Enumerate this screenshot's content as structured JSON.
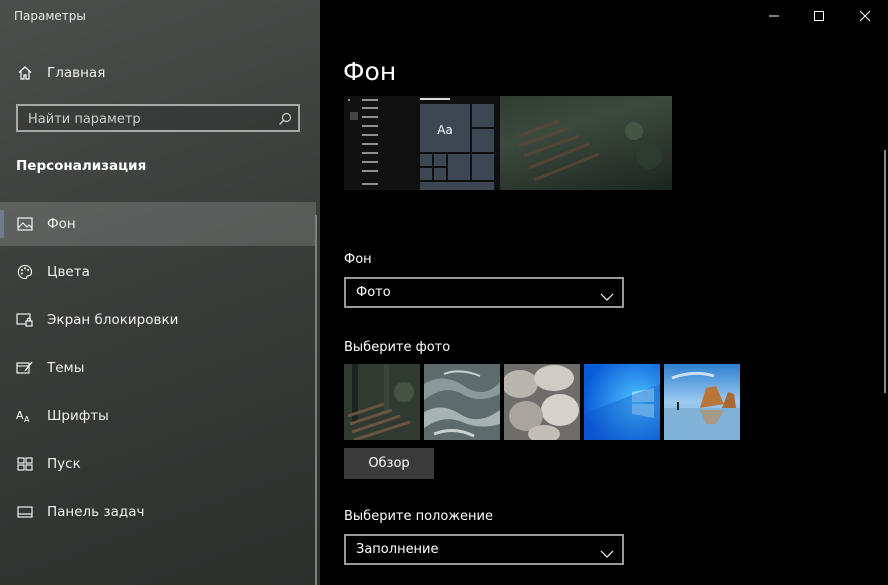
{
  "window": {
    "title": "Параметры"
  },
  "sidebar": {
    "home_label": "Главная",
    "search_placeholder": "Найти параметр",
    "section_title": "Персонализация",
    "items": [
      {
        "label": "Фон",
        "icon": "picture-icon",
        "active": true
      },
      {
        "label": "Цвета",
        "icon": "palette-icon"
      },
      {
        "label": "Экран блокировки",
        "icon": "lock-screen-icon"
      },
      {
        "label": "Темы",
        "icon": "themes-icon"
      },
      {
        "label": "Шрифты",
        "icon": "fonts-icon"
      },
      {
        "label": "Пуск",
        "icon": "start-icon"
      },
      {
        "label": "Панель задач",
        "icon": "taskbar-icon"
      }
    ]
  },
  "main": {
    "title": "Фон",
    "preview": {
      "tile_text": "Aa"
    },
    "background_label": "Фон",
    "background_value": "Фото",
    "choose_photo_label": "Выберите фото",
    "browse_label": "Обзор",
    "fit_label": "Выберите положение",
    "fit_value": "Заполнение"
  },
  "colors": {
    "sidebar_bg": "#3d413e",
    "main_bg": "#000000",
    "tile": "#3c4753"
  }
}
